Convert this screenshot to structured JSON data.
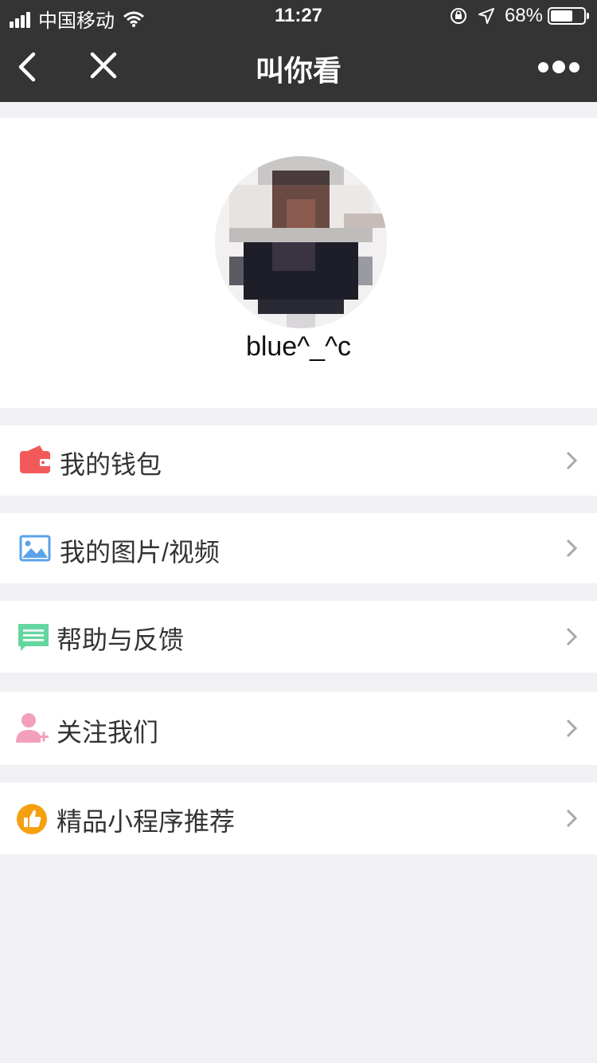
{
  "status_bar": {
    "carrier": "中国移动",
    "time": "11:27",
    "battery": "68%",
    "battery_level": 0.68
  },
  "nav": {
    "title": "叫你看",
    "back_icon": "chevron-left-icon",
    "close_icon": "close-icon",
    "more_icon": "more-dots-icon"
  },
  "profile": {
    "username": "blue^_^c"
  },
  "menu": [
    {
      "label": "我的钱包",
      "icon": "wallet-icon",
      "color": "#f25a5a"
    },
    {
      "label": "我的图片/视频",
      "icon": "image-icon",
      "color": "#5aa3e8"
    },
    {
      "label": "帮助与反馈",
      "icon": "chat-icon",
      "color": "#66d6a0"
    },
    {
      "label": "关注我们",
      "icon": "add-user-icon",
      "color": "#f2a0bd"
    },
    {
      "label": "精品小程序推荐",
      "icon": "thumbs-up-icon",
      "color": "#f5a010"
    }
  ]
}
